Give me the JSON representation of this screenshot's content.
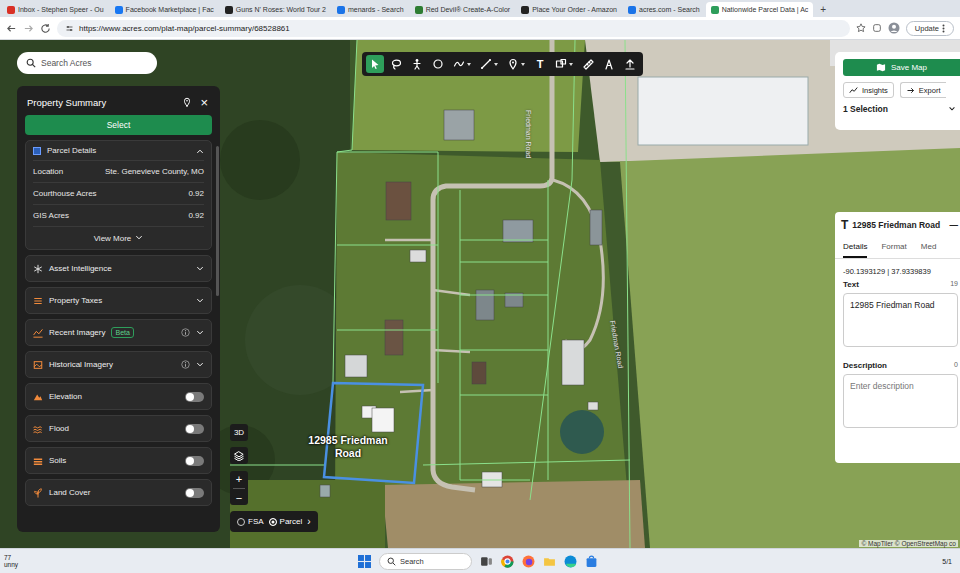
{
  "browser": {
    "tabs": [
      {
        "label": "Inbox - Stephen Speer - Ou",
        "selected": false
      },
      {
        "label": "Facebook Marketplace | Fac",
        "selected": false
      },
      {
        "label": "Guns N' Roses: World Tour 2",
        "selected": false
      },
      {
        "label": "menards - Search",
        "selected": false
      },
      {
        "label": "Red Devil® Create-A-Color",
        "selected": false
      },
      {
        "label": "Place Your Order - Amazon",
        "selected": false
      },
      {
        "label": "acres.com - Search",
        "selected": false
      },
      {
        "label": "Nationwide Parcel Data | Ac",
        "selected": true
      }
    ],
    "new_tab": "+",
    "url": "https://www.acres.com/plat-map/parcel-summary/68528861",
    "update_button": "Update"
  },
  "map": {
    "search_placeholder": "Search Acres",
    "tools": [
      {
        "kind": "select",
        "selected": true,
        "menu": false
      },
      {
        "kind": "lasso",
        "selected": false,
        "menu": false
      },
      {
        "kind": "figure",
        "selected": false,
        "menu": false
      },
      {
        "kind": "circle",
        "selected": false,
        "menu": false
      },
      {
        "kind": "draw",
        "selected": false,
        "menu": true
      },
      {
        "kind": "line",
        "selected": false,
        "menu": true
      },
      {
        "kind": "marker",
        "selected": false,
        "menu": true
      },
      {
        "kind": "text",
        "selected": false,
        "menu": false,
        "label": "T"
      },
      {
        "kind": "shape",
        "selected": false,
        "menu": true
      },
      {
        "kind": "ruler",
        "selected": false,
        "menu": false
      },
      {
        "kind": "compass",
        "selected": false,
        "menu": false
      },
      {
        "kind": "upload",
        "selected": false,
        "menu": false
      }
    ],
    "parcel_label": "12985 Friedman Road",
    "road_labels": [
      "Friedman Road",
      "Friedman Road"
    ],
    "view_3d": "3D",
    "zoom_in": "+",
    "zoom_out": "−",
    "base_layers": [
      {
        "label": "FSA",
        "selected": false
      },
      {
        "label": "Parcel",
        "selected": true
      }
    ],
    "base_layer_more": "›",
    "attribution": "© MapTiler © OpenStreetMap co"
  },
  "property_panel": {
    "title": "Property Summary",
    "close": "×",
    "select_button": "Select",
    "parcel_details": {
      "title": "Parcel Details",
      "expanded": true,
      "fields": [
        {
          "label": "Location",
          "value": "Ste. Genevieve County, MO"
        },
        {
          "label": "Courthouse Acres",
          "value": "0.92"
        },
        {
          "label": "GIS Acres",
          "value": "0.92"
        }
      ],
      "view_more": "View More"
    },
    "sections": [
      {
        "label": "Asset Intelligence",
        "kind": "expand"
      },
      {
        "label": "Property Taxes",
        "kind": "expand"
      },
      {
        "label": "Recent Imagery",
        "kind": "expand-info",
        "badge": "Beta"
      },
      {
        "label": "Historical Imagery",
        "kind": "expand-info"
      },
      {
        "label": "Elevation",
        "kind": "toggle",
        "on": false
      },
      {
        "label": "Flood",
        "kind": "toggle",
        "on": false
      },
      {
        "label": "Soils",
        "kind": "toggle",
        "on": false
      },
      {
        "label": "Land Cover",
        "kind": "toggle",
        "on": false
      }
    ]
  },
  "right_panel": {
    "save_map": "Save Map",
    "insights": "Insights",
    "export": "Export",
    "selection": "1 Selection"
  },
  "annotation": {
    "glyph": "T",
    "title": "12985 Friedman Road",
    "collapse": "—",
    "tabs": [
      {
        "label": "Details",
        "selected": true
      },
      {
        "label": "Format",
        "selected": false
      },
      {
        "label": "Med",
        "selected": false
      }
    ],
    "coords": "-90.1393129 | 37.9339839",
    "text_label": "Text",
    "text_count": "19",
    "text_value": "12985 Friedman Road",
    "description_label": "Description",
    "description_count": "0",
    "description_placeholder": "Enter description"
  },
  "taskbar": {
    "weather_temp": "77",
    "weather_text": "unny",
    "search": "Search",
    "clock": "5/1"
  }
}
